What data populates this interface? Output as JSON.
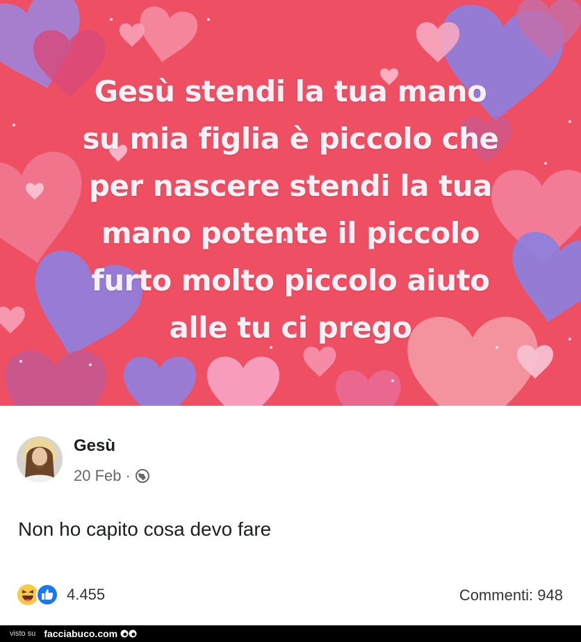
{
  "banner": {
    "lines": [
      "Gesù stendi la tua mano",
      "su mia figlia è piccolo che",
      "per nascere stendi la tua",
      "mano potente il piccolo",
      "furto molto piccolo aiuto",
      "alle tu ci prego"
    ],
    "background_color": "#ee4f63"
  },
  "post": {
    "author": "Gesù",
    "date": "20 Feb",
    "separator": "·",
    "privacy_icon": "globe-icon",
    "message": "Non ho capito cosa devo fare",
    "reactions": {
      "icons": [
        "haha-emoji-icon",
        "like-thumb-icon"
      ],
      "count": "4.455"
    },
    "comments": "Commenti: 948"
  },
  "footer": {
    "visto": "visto su",
    "site": "facciabuco.com",
    "logo_icon": "eyes-logo-icon"
  }
}
